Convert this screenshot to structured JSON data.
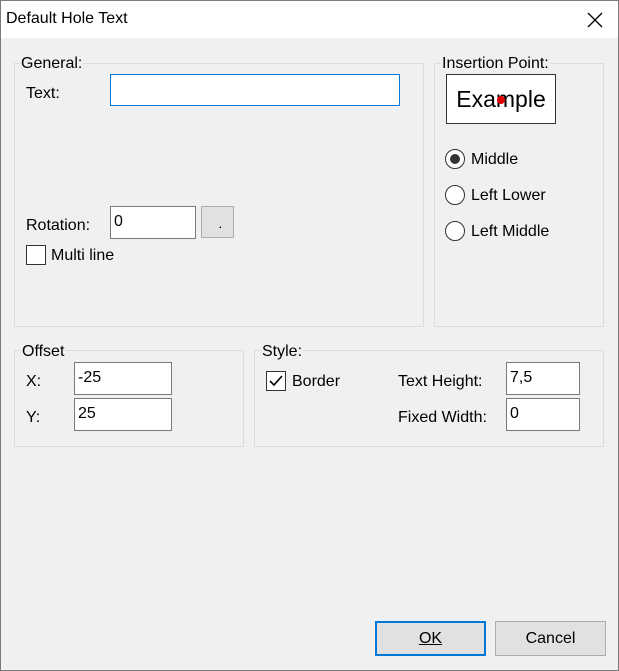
{
  "window": {
    "title": "Default Hole Text"
  },
  "general": {
    "legend": "General:",
    "text_label": "Text:",
    "text_value": "",
    "rotation_label": "Rotation:",
    "rotation_value": "0",
    "multiline_label": "Multi line",
    "multiline_checked": false
  },
  "insertion": {
    "legend": "Insertion Point:",
    "example_text": "Example",
    "options": [
      {
        "label": "Middle",
        "selected": true
      },
      {
        "label": "Left Lower",
        "selected": false
      },
      {
        "label": "Left Middle",
        "selected": false
      }
    ]
  },
  "offset": {
    "legend": "Offset",
    "x_label": "X:",
    "x_value": "-25",
    "y_label": "Y:",
    "y_value": "25"
  },
  "style": {
    "legend": "Style:",
    "border_label": "Border",
    "border_checked": true,
    "text_height_label": "Text Height:",
    "text_height_value": "7,5",
    "fixed_width_label": "Fixed Width:",
    "fixed_width_value": "0"
  },
  "buttons": {
    "ok_label": "OK",
    "cancel_label": "Cancel"
  },
  "colors": {
    "accent": "#0078d7",
    "insertion_dot": "#e00000",
    "dialog_bg": "#f0f0f0"
  }
}
